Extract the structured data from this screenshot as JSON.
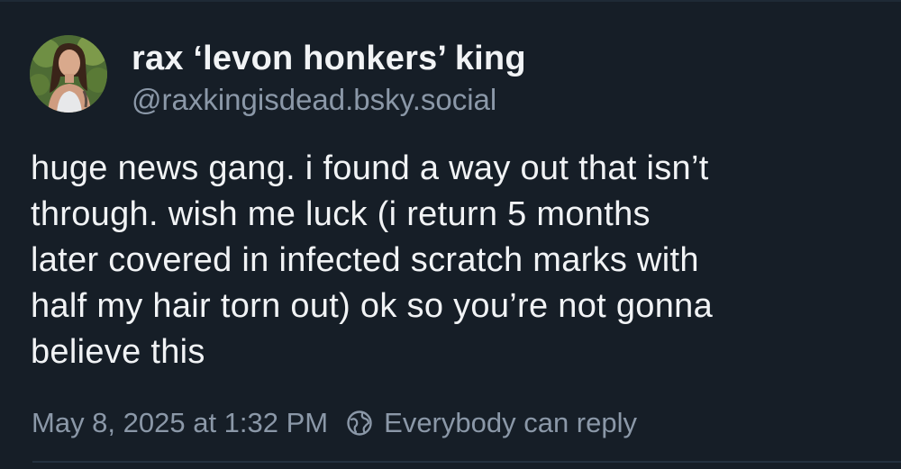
{
  "author": {
    "display_name": "rax ‘levon honkers’ king",
    "handle": "@raxkingisdead.bsky.social",
    "avatar_icon": "profile-photo"
  },
  "post": {
    "text": "huge news gang. i found a way out that isn’t\nthrough. wish me luck (i return 5 months\nlater covered in infected scratch marks with\nhalf my hair torn out) ok so you’re not gonna\nbelieve this"
  },
  "meta": {
    "timestamp": "May 8, 2025 at 1:32 PM",
    "reply_setting": "Everybody can reply",
    "reply_icon": "globe-icon"
  },
  "colors": {
    "background": "#161e27",
    "text_primary": "#f1f3f5",
    "text_secondary": "#8b98a8"
  }
}
